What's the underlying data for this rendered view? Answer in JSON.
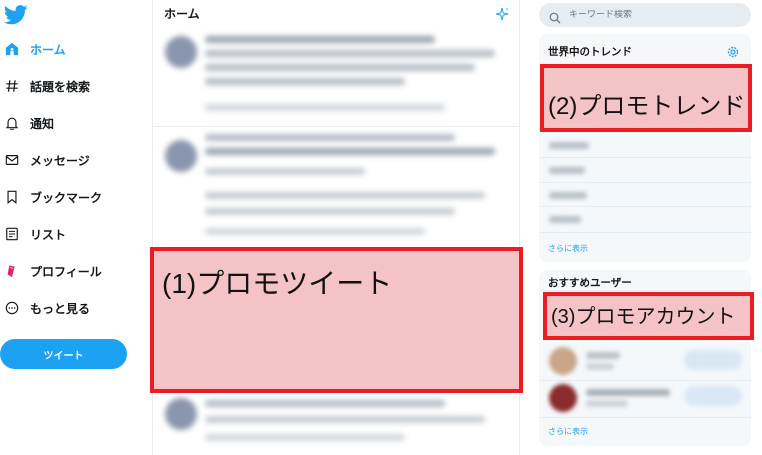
{
  "nav": {
    "items": [
      {
        "label": "ホーム",
        "icon": "home-icon",
        "active": true
      },
      {
        "label": "話題を検索",
        "icon": "hashtag-icon",
        "active": false
      },
      {
        "label": "通知",
        "icon": "bell-icon",
        "active": false
      },
      {
        "label": "メッセージ",
        "icon": "envelope-icon",
        "active": false
      },
      {
        "label": "ブックマーク",
        "icon": "bookmark-icon",
        "active": false
      },
      {
        "label": "リスト",
        "icon": "list-icon",
        "active": false
      },
      {
        "label": "プロフィール",
        "icon": "profile-icon",
        "active": false
      },
      {
        "label": "もっと見る",
        "icon": "more-icon",
        "active": false
      }
    ],
    "tweet_button": "ツイート"
  },
  "timeline": {
    "title": "ホーム"
  },
  "search": {
    "placeholder": "キーワード検索"
  },
  "trends": {
    "title": "世界中のトレンド",
    "show_more": "さらに表示"
  },
  "who_to_follow": {
    "title": "おすすめユーザー",
    "show_more": "さらに表示"
  },
  "annotations": {
    "promo_tweet": "(1)プロモツイート",
    "promo_trend": "(2)プロモトレンド",
    "promo_account": "(3)プロモアカウント"
  },
  "colors": {
    "accent": "#1da1f2",
    "annotation_border": "#ea1c24",
    "annotation_fill": "#f3c3c6"
  }
}
